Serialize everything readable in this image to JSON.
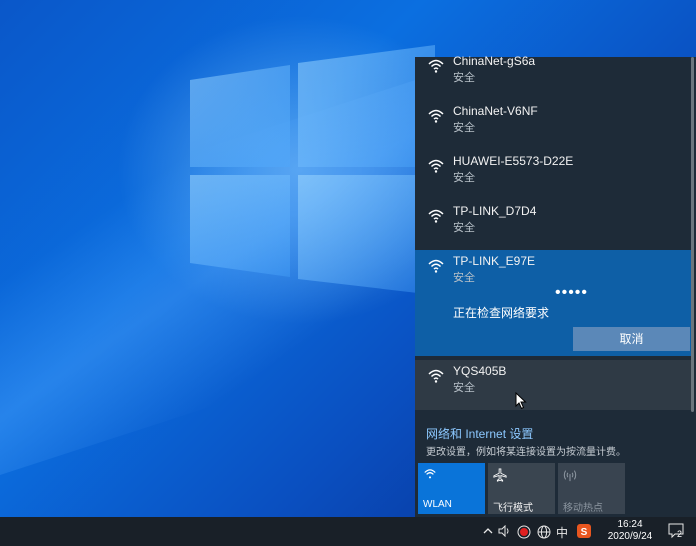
{
  "wifi_list": {
    "networks": [
      {
        "ssid": "ChinaNet-gS6a",
        "security": "安全"
      },
      {
        "ssid": "ChinaNet-V6NF",
        "security": "安全"
      },
      {
        "ssid": "HUAWEI-E5573-D22E",
        "security": "安全"
      },
      {
        "ssid": "TP-LINK_D7D4",
        "security": "安全"
      },
      {
        "ssid": "TP-LINK_E97E",
        "security": "安全"
      },
      {
        "ssid": "YQS405B",
        "security": "安全"
      }
    ],
    "selected": {
      "status": "正在检查网络要求",
      "progress_dots": "•••••",
      "cancel_label": "取消"
    }
  },
  "settings": {
    "link": "网络和 Internet 设置",
    "description": "更改设置，例如将某连接设置为按流量计费。"
  },
  "quick_actions": [
    {
      "label": "WLAN",
      "icon": "wifi-icon",
      "state": "on"
    },
    {
      "label": "飞行模式",
      "icon": "airplane-icon",
      "state": "off"
    },
    {
      "label": "移动热点",
      "icon": "hotspot-icon",
      "state": "disabled"
    }
  ],
  "taskbar": {
    "ime": "中",
    "time": "16:24",
    "date": "2020/9/24",
    "notification_count": "2"
  },
  "colors": {
    "panel_bg": "#1e2b38",
    "accent": "#0a74d9",
    "selected_row": "#0e5fa6"
  }
}
